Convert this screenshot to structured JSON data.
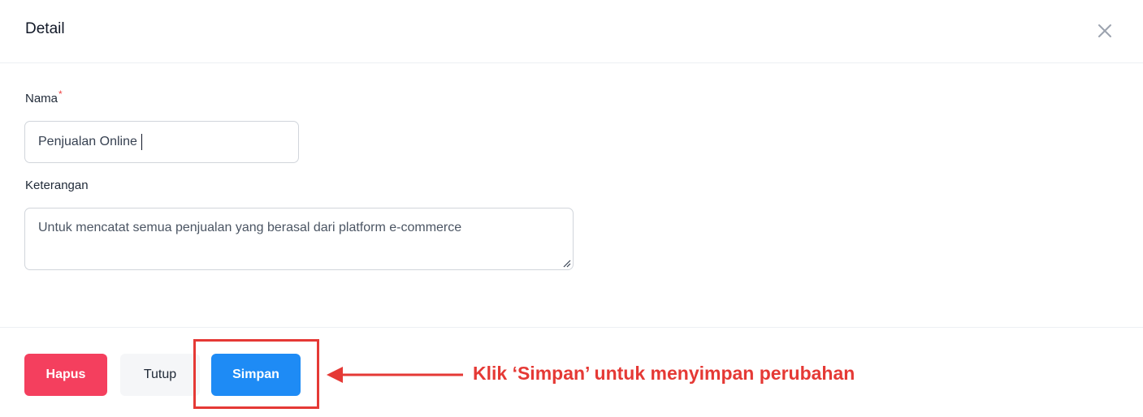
{
  "dialog": {
    "title": "Detail",
    "close_icon": "close-icon"
  },
  "form": {
    "nama": {
      "label": "Nama",
      "required_mark": "*",
      "value": "Penjualan Online"
    },
    "keterangan": {
      "label": "Keterangan",
      "value": "Untuk mencatat semua penjualan yang berasal dari platform e-commerce"
    }
  },
  "footer": {
    "hapus_label": "Hapus",
    "tutup_label": "Tutup",
    "simpan_label": "Simpan"
  },
  "annotation": {
    "text": "Klik ‘Simpan’ untuk menyimpan perubahan",
    "arrow_icon": "arrow-left-icon"
  },
  "colors": {
    "danger": "#f43f5e",
    "primary": "#1e8bf5",
    "secondary_bg": "#f5f6f8",
    "annotation": "#e53935",
    "required": "#ef4444"
  }
}
